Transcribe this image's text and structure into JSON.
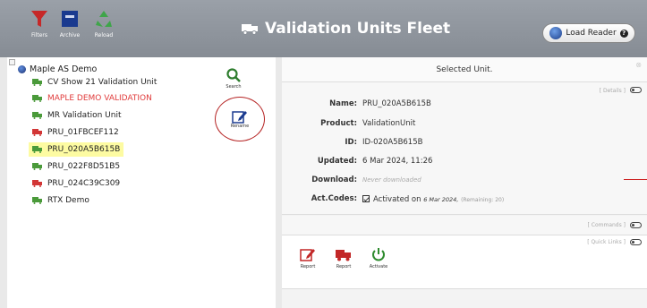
{
  "toolbar": {
    "filters_label": "Filters",
    "archive_label": "Archive",
    "reload_label": "Reload"
  },
  "title": "Validation Units Fleet",
  "load_reader_label": "Load Reader",
  "tree": {
    "root_label": "Maple AS Demo",
    "items": [
      {
        "label": "CV Show 21 Validation Unit",
        "color": "#4a9a3a"
      },
      {
        "label": "MAPLE DEMO VALIDATION",
        "color": "#e03b3b"
      },
      {
        "label": "MR Validation Unit",
        "color": "#4a9a3a"
      },
      {
        "label": "PRU_01FBCEF112",
        "color": "#d23636"
      },
      {
        "label": "PRU_020A5B615B",
        "color": "#4a9a3a"
      },
      {
        "label": "PRU_022F8D51B5",
        "color": "#4a9a3a"
      },
      {
        "label": "PRU_024C39C309",
        "color": "#d23636"
      },
      {
        "label": "RTX Demo",
        "color": "#4a9a3a"
      }
    ]
  },
  "side_actions": {
    "search_label": "Search",
    "rename_label": "Rename"
  },
  "details": {
    "header": "Selected Unit.",
    "details_tag": "[ Details ]",
    "name_label": "Name:",
    "name_value": "PRU_020A5B615B",
    "product_label": "Product:",
    "product_value": "ValidationUnit",
    "id_label": "ID:",
    "id_value": "ID-020A5B615B",
    "updated_label": "Updated:",
    "updated_value": "6 Mar 2024, 11:26",
    "download_label": "Download:",
    "download_value": "Never downloaded",
    "actcodes_label": "Act.Codes:",
    "actcodes_prefix": "Activated on",
    "actcodes_date": "6 Mar 2024,",
    "actcodes_remaining": "(Remaining: 20)",
    "commands_tag": "[ Commands ]",
    "quicklinks_tag": "[ Quick Links ]"
  },
  "quick_links": [
    {
      "label": "Report"
    },
    {
      "label": "Report"
    },
    {
      "label": "Activate"
    }
  ],
  "colors": {
    "accent_red": "#c22727",
    "green": "#4a9a3a",
    "highlight": "#fdfba2"
  }
}
